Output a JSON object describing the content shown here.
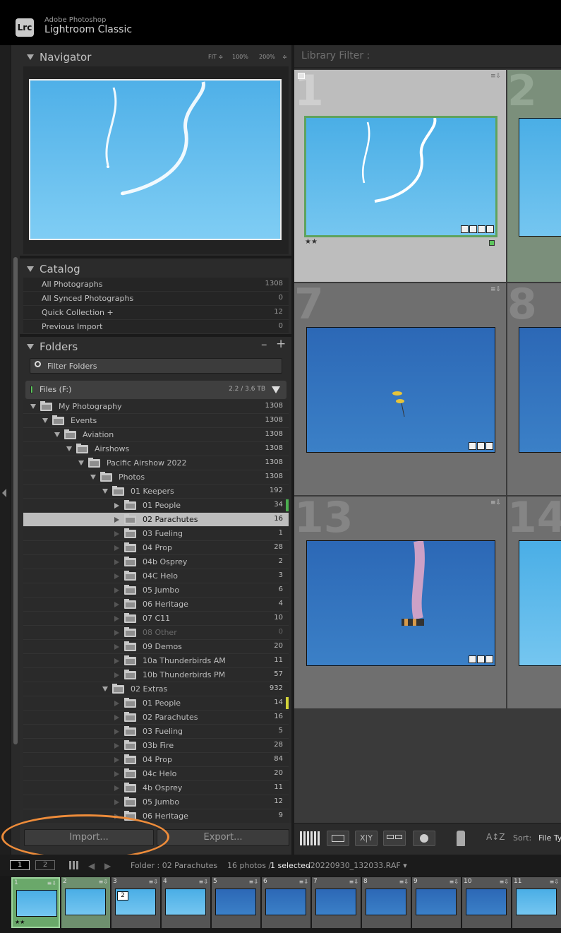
{
  "app": {
    "vendor": "Adobe Photoshop",
    "product": "Lightroom Classic",
    "logo_text": "Lrc"
  },
  "navigator": {
    "title": "Navigator",
    "zoom_options": [
      "FIT ≑",
      "100%",
      "200%",
      "≑"
    ]
  },
  "catalog": {
    "title": "Catalog",
    "items": [
      {
        "label": "All Photographs",
        "count": "1308"
      },
      {
        "label": "All Synced Photographs",
        "count": "0"
      },
      {
        "label": "Quick Collection +",
        "count": "12"
      },
      {
        "label": "Previous Import",
        "count": "0"
      }
    ]
  },
  "folders": {
    "title": "Folders",
    "minus": "–",
    "plus": "+",
    "filter_placeholder": "Filter Folders",
    "drive": {
      "label": "Files (F:)",
      "size": "2.2 / 3.6 TB"
    },
    "rows": [
      {
        "label": "My Photography",
        "count": "1308",
        "depth": 0,
        "state": "open"
      },
      {
        "label": "Events",
        "count": "1308",
        "depth": 1,
        "state": "open"
      },
      {
        "label": "Aviation",
        "count": "1308",
        "depth": 2,
        "state": "open"
      },
      {
        "label": "Airshows",
        "count": "1308",
        "depth": 3,
        "state": "open"
      },
      {
        "label": "Pacific Airshow 2022",
        "count": "1308",
        "depth": 4,
        "state": "open"
      },
      {
        "label": "Photos",
        "count": "1308",
        "depth": 5,
        "state": "open"
      },
      {
        "label": "01 Keepers",
        "count": "192",
        "depth": 6,
        "state": "open"
      },
      {
        "label": "01 People",
        "count": "34",
        "depth": 7,
        "state": "closed",
        "mark": "#4caf50"
      },
      {
        "label": "02 Parachutes",
        "count": "16",
        "depth": 7,
        "state": "empty",
        "selected": true
      },
      {
        "label": "03 Fueling",
        "count": "1",
        "depth": 7,
        "state": "empty"
      },
      {
        "label": "04 Prop",
        "count": "28",
        "depth": 7,
        "state": "empty"
      },
      {
        "label": "04b Osprey",
        "count": "2",
        "depth": 7,
        "state": "empty"
      },
      {
        "label": "04C Helo",
        "count": "3",
        "depth": 7,
        "state": "empty"
      },
      {
        "label": "05 Jumbo",
        "count": "6",
        "depth": 7,
        "state": "empty"
      },
      {
        "label": "06 Heritage",
        "count": "4",
        "depth": 7,
        "state": "empty"
      },
      {
        "label": "07 C11",
        "count": "10",
        "depth": 7,
        "state": "empty"
      },
      {
        "label": "08 Other",
        "count": "0",
        "depth": 7,
        "state": "empty",
        "dim": true
      },
      {
        "label": "09 Demos",
        "count": "20",
        "depth": 7,
        "state": "empty"
      },
      {
        "label": "10a Thunderbirds AM",
        "count": "11",
        "depth": 7,
        "state": "empty"
      },
      {
        "label": "10b  Thunderbirds PM",
        "count": "57",
        "depth": 7,
        "state": "empty"
      },
      {
        "label": "02 Extras",
        "count": "932",
        "depth": 6,
        "state": "open"
      },
      {
        "label": "01 People",
        "count": "14",
        "depth": 7,
        "state": "empty",
        "mark": "#d4d43a"
      },
      {
        "label": "02 Parachutes",
        "count": "16",
        "depth": 7,
        "state": "empty"
      },
      {
        "label": "03 Fueling",
        "count": "5",
        "depth": 7,
        "state": "empty"
      },
      {
        "label": "03b Fire",
        "count": "28",
        "depth": 7,
        "state": "empty"
      },
      {
        "label": "04 Prop",
        "count": "84",
        "depth": 7,
        "state": "empty"
      },
      {
        "label": "04c Helo",
        "count": "20",
        "depth": 7,
        "state": "empty"
      },
      {
        "label": "4b Osprey",
        "count": "11",
        "depth": 7,
        "state": "empty"
      },
      {
        "label": "05 Jumbo",
        "count": "12",
        "depth": 7,
        "state": "empty"
      },
      {
        "label": "06 Heritage",
        "count": "9",
        "depth": 7,
        "state": "empty"
      }
    ]
  },
  "buttons": {
    "import": "Import...",
    "export": "Export..."
  },
  "library_filter": "Library Filter :",
  "grid": {
    "cells": [
      {
        "num": "1",
        "stars": "★★"
      },
      {
        "num": "2"
      },
      {
        "num": "7"
      },
      {
        "num": "8"
      },
      {
        "num": "13"
      },
      {
        "num": "14"
      }
    ],
    "badge": "≡⇩"
  },
  "toolbar": {
    "compare": "X|Y",
    "sort_label": "Sort:",
    "sort_value": "File Ty",
    "az": "A↕Z"
  },
  "filmstrip": {
    "screen1": "1",
    "screen2": "2",
    "source": "Folder : 02 Parachutes",
    "count": "16 photos /",
    "selected": "1 selected",
    "filename": "/20220930_132033.RAF ▾",
    "stack_count": "2",
    "stars": "★★",
    "cells": [
      "1",
      "2",
      "3",
      "4",
      "5",
      "6",
      "7",
      "8",
      "9",
      "10",
      "11"
    ]
  }
}
